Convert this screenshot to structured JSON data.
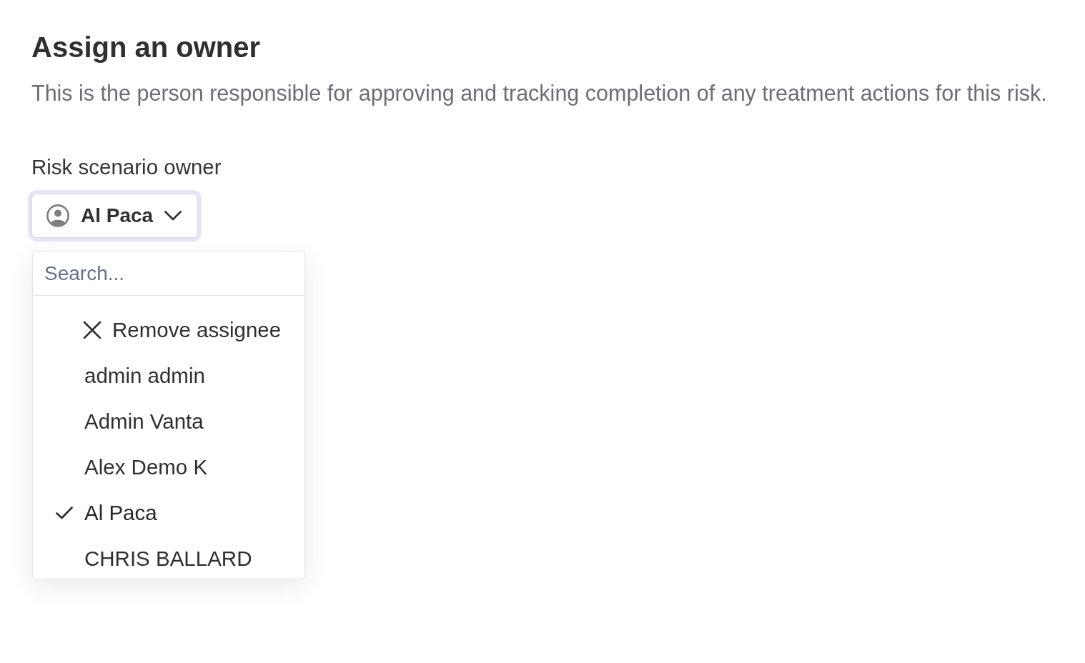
{
  "heading": "Assign an owner",
  "description": "This is the person responsible for approving and tracking completion of any treatment actions for this risk.",
  "field": {
    "label": "Risk scenario owner",
    "value": "Al Paca",
    "focused": true
  },
  "dropdown": {
    "search": {
      "placeholder": "Search..."
    },
    "options": [
      {
        "kind": "action",
        "label": "Remove assignee",
        "selected": false
      },
      {
        "kind": "person",
        "label": "admin admin",
        "selected": false
      },
      {
        "kind": "person",
        "label": "Admin Vanta",
        "selected": false
      },
      {
        "kind": "person",
        "label": "Alex Demo K",
        "selected": false
      },
      {
        "kind": "person",
        "label": "Al Paca",
        "selected": true
      },
      {
        "kind": "person",
        "label": "CHRIS BALLARD",
        "selected": false
      }
    ]
  }
}
